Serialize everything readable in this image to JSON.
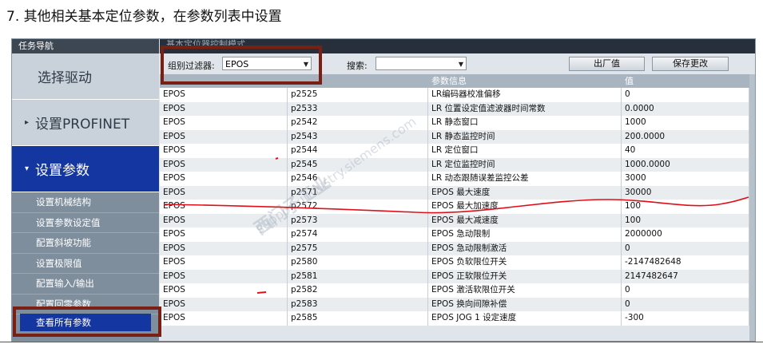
{
  "heading": "7. 其他相关基本定位参数，在参数列表中设置",
  "sidebar": {
    "title": "任务导航",
    "items": [
      {
        "label": "选择驱动",
        "arrow": ""
      },
      {
        "label": "设置PROFINET",
        "arrow": "▸"
      },
      {
        "label": "设置参数",
        "arrow": "▾"
      }
    ],
    "subitems": [
      "设置机械结构",
      "设置参数设定值",
      "配置斜坡功能",
      "设置极限值",
      "配置输入/输出",
      "配置回零参数"
    ],
    "view_all": "查看所有参数"
  },
  "main": {
    "header": "基本定位器控制模式",
    "filter_label": "组别过滤器:",
    "filter_value": "EPOS",
    "search_label": "搜索:",
    "search_value": "",
    "factory_button": "出厂值",
    "save_button": "保存更改",
    "columns": [
      "",
      "",
      "参数信息",
      "值"
    ],
    "rows": [
      {
        "group": "EPOS",
        "param": "p2525",
        "info": "LR编码器校准偏移",
        "value": "0"
      },
      {
        "group": "EPOS",
        "param": "p2533",
        "info": "LR 位置设定值滤波器时间常数",
        "value": "0.0000"
      },
      {
        "group": "EPOS",
        "param": "p2542",
        "info": "LR 静态窗口",
        "value": "1000"
      },
      {
        "group": "EPOS",
        "param": "p2543",
        "info": "LR 静态监控时间",
        "value": "200.0000"
      },
      {
        "group": "EPOS",
        "param": "p2544",
        "info": "LR 定位窗口",
        "value": "40"
      },
      {
        "group": "EPOS",
        "param": "p2545",
        "info": "LR 定位监控时间",
        "value": "1000.0000"
      },
      {
        "group": "EPOS",
        "param": "p2546",
        "info": "LR 动态跟随误差监控公差",
        "value": "3000"
      },
      {
        "group": "EPOS",
        "param": "p2571",
        "info": "EPOS 最大速度",
        "value": "30000"
      },
      {
        "group": "EPOS",
        "param": "p2572",
        "info": "EPOS 最大加速度",
        "value": "100"
      },
      {
        "group": "EPOS",
        "param": "p2573",
        "info": "EPOS 最大减速度",
        "value": "100"
      },
      {
        "group": "EPOS",
        "param": "p2574",
        "info": "EPOS 急动限制",
        "value": "2000000"
      },
      {
        "group": "EPOS",
        "param": "p2575",
        "info": "EPOS 急动限制激活",
        "value": "0"
      },
      {
        "group": "EPOS",
        "param": "p2580",
        "info": "EPOS 负软限位开关",
        "value": "-2147482648"
      },
      {
        "group": "EPOS",
        "param": "p2581",
        "info": "EPOS 正软限位开关",
        "value": "2147482647"
      },
      {
        "group": "EPOS",
        "param": "p2582",
        "info": "EPOS 激活软限位开关",
        "value": "0"
      },
      {
        "group": "EPOS",
        "param": "p2583",
        "info": "EPOS 换向间隙补偿",
        "value": "0"
      },
      {
        "group": "EPOS",
        "param": "p2585",
        "info": "EPOS JOG 1 设定速度",
        "value": "-300"
      }
    ]
  },
  "watermark": [
    "西门子工业",
    "support.industry.siemens.com"
  ],
  "colors": {
    "annotation": "#7a1f14",
    "selected": "#1436a0",
    "pen": "#e0101a"
  }
}
